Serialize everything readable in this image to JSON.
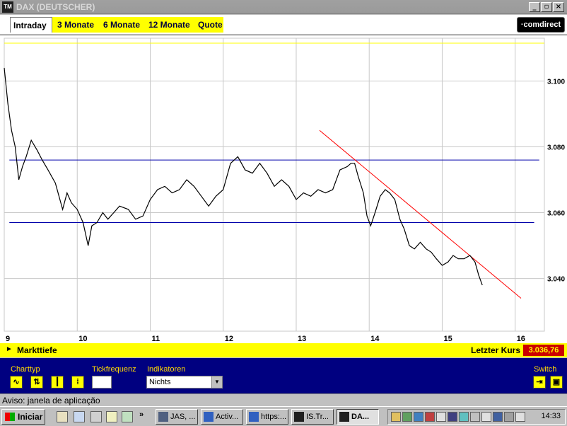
{
  "window": {
    "title": "DAX (DEUTSCHER)",
    "logo_text": "TM",
    "buttons": {
      "minimize": "_",
      "restore": "▫",
      "close": "×"
    }
  },
  "tabs": [
    {
      "label": "Intraday",
      "active": true
    },
    {
      "label": "3 Monate",
      "active": false
    },
    {
      "label": "6 Monate",
      "active": false
    },
    {
      "label": "12 Monate",
      "active": false
    },
    {
      "label": "Quote",
      "active": false
    }
  ],
  "brand": "·comdirect",
  "chart_data": {
    "type": "line",
    "title": "",
    "xlabel": "",
    "ylabel": "",
    "x_ticks": [
      "9",
      "10",
      "11",
      "12",
      "13",
      "14",
      "15",
      "16"
    ],
    "y_ticks": [
      "3.100",
      "3.080",
      "3.060",
      "3.040"
    ],
    "y_tick_values": [
      3100,
      3080,
      3060,
      3040
    ],
    "xlim": [
      9,
      16.4
    ],
    "ylim": [
      3024,
      3113
    ],
    "grid": true,
    "series": [
      {
        "color": "#000000",
        "points": [
          [
            9.0,
            3104
          ],
          [
            9.05,
            3093
          ],
          [
            9.1,
            3085
          ],
          [
            9.15,
            3080
          ],
          [
            9.2,
            3070
          ],
          [
            9.25,
            3074
          ],
          [
            9.3,
            3077
          ],
          [
            9.37,
            3082
          ],
          [
            9.45,
            3079
          ],
          [
            9.52,
            3076
          ],
          [
            9.6,
            3073
          ],
          [
            9.7,
            3069
          ],
          [
            9.8,
            3061
          ],
          [
            9.86,
            3066
          ],
          [
            9.92,
            3063
          ],
          [
            10.0,
            3061
          ],
          [
            10.08,
            3057
          ],
          [
            10.15,
            3050
          ],
          [
            10.2,
            3056
          ],
          [
            10.27,
            3057
          ],
          [
            10.35,
            3060
          ],
          [
            10.42,
            3058
          ],
          [
            10.5,
            3060
          ],
          [
            10.58,
            3062
          ],
          [
            10.7,
            3061
          ],
          [
            10.8,
            3058
          ],
          [
            10.9,
            3059
          ],
          [
            11.0,
            3064
          ],
          [
            11.1,
            3067
          ],
          [
            11.2,
            3068
          ],
          [
            11.3,
            3066
          ],
          [
            11.4,
            3067
          ],
          [
            11.5,
            3070
          ],
          [
            11.6,
            3068
          ],
          [
            11.7,
            3065
          ],
          [
            11.8,
            3062
          ],
          [
            11.9,
            3065
          ],
          [
            12.0,
            3067
          ],
          [
            12.1,
            3075
          ],
          [
            12.2,
            3077
          ],
          [
            12.3,
            3073
          ],
          [
            12.4,
            3072
          ],
          [
            12.5,
            3075
          ],
          [
            12.6,
            3072
          ],
          [
            12.7,
            3068
          ],
          [
            12.8,
            3070
          ],
          [
            12.9,
            3068
          ],
          [
            13.0,
            3064
          ],
          [
            13.1,
            3066
          ],
          [
            13.2,
            3065
          ],
          [
            13.3,
            3067
          ],
          [
            13.4,
            3066
          ],
          [
            13.5,
            3067
          ],
          [
            13.6,
            3073
          ],
          [
            13.7,
            3074
          ],
          [
            13.75,
            3075
          ],
          [
            13.8,
            3075
          ],
          [
            13.85,
            3071
          ],
          [
            13.92,
            3066
          ],
          [
            13.97,
            3059
          ],
          [
            14.02,
            3056
          ],
          [
            14.08,
            3060
          ],
          [
            14.15,
            3065
          ],
          [
            14.22,
            3067
          ],
          [
            14.28,
            3066
          ],
          [
            14.35,
            3064
          ],
          [
            14.42,
            3058
          ],
          [
            14.48,
            3055
          ],
          [
            14.55,
            3050
          ],
          [
            14.62,
            3049
          ],
          [
            14.7,
            3051
          ],
          [
            14.78,
            3049
          ],
          [
            14.85,
            3048
          ],
          [
            14.92,
            3046
          ],
          [
            15.0,
            3044
          ],
          [
            15.08,
            3045
          ],
          [
            15.15,
            3047
          ],
          [
            15.22,
            3046
          ],
          [
            15.3,
            3046
          ],
          [
            15.38,
            3047
          ],
          [
            15.45,
            3045
          ],
          [
            15.5,
            3041
          ],
          [
            15.55,
            3038
          ]
        ]
      }
    ],
    "trendlines": {
      "horizontal": [
        {
          "y": 3111.5,
          "color": "#ffff00"
        },
        {
          "y": 3076,
          "x1": 9.07,
          "x2": 16.33,
          "color": "#0000aa"
        },
        {
          "y": 3057,
          "x1": 9.07,
          "x2": 16.26,
          "color": "#0000aa"
        }
      ],
      "sloped": [
        {
          "x1": 13.32,
          "y1": 3085,
          "x2": 16.08,
          "y2": 3034,
          "color": "#ff0000"
        }
      ]
    }
  },
  "info_bar": {
    "left_arrow": "►",
    "left_label": "Markttiefe",
    "right_label": "Letzter Kurs",
    "last_price": "3.036,76"
  },
  "panel": {
    "charttyp_label": "Charttyp",
    "tickfrequenz_label": "Tickfrequenz",
    "indikatoren_label": "Indikatoren",
    "indikatoren_value": "Nichts",
    "switch_label": "Switch",
    "charttyp_buttons": [
      {
        "icon": "line-chart-icon",
        "glyph": "∿"
      },
      {
        "icon": "bar-chart-icon",
        "glyph": "⇅"
      },
      {
        "icon": "candle-chart-icon",
        "glyph": "┃"
      },
      {
        "icon": "point-chart-icon",
        "glyph": "⁞"
      }
    ]
  },
  "status": {
    "text": "Aviso: janela de aplicação"
  },
  "taskbar": {
    "start_label": "Iniciar",
    "tasks": [
      {
        "label": "JAS, ...",
        "active": false
      },
      {
        "label": "Activ...",
        "active": false
      },
      {
        "label": "https:...",
        "active": false
      },
      {
        "label": "IS.Tr...",
        "active": false
      },
      {
        "label": "DA...",
        "active": true
      }
    ],
    "clock": "14:33",
    "quicklaunch_more": "»"
  }
}
